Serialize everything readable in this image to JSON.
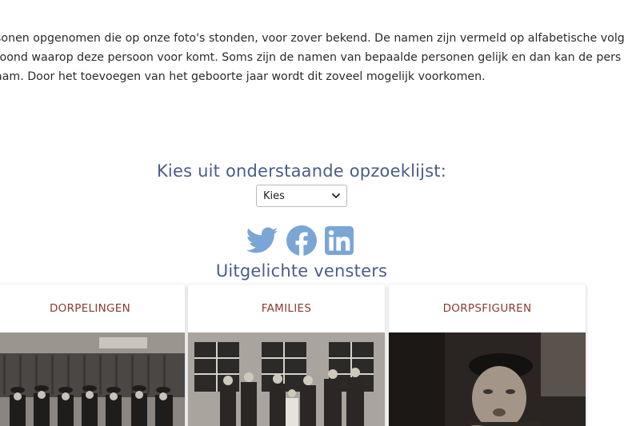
{
  "intro": {
    "line1": "sonen opgenomen die op onze foto's stonden, voor zover bekend. De namen zijn vermeld op alfabetische volg",
    "line2": "roond waarop deze persoon voor komt. Soms zijn de namen van bepaalde personen gelijk en dan kan de pers",
    "line3": "aam. Door het toevoegen van het geboorte jaar wordt dit zoveel mogelijk voorkomen."
  },
  "lookup": {
    "title": "Kies uit onderstaande opzoeklijst:",
    "selected": "Kies"
  },
  "social": {
    "icons": [
      "twitter-icon",
      "facebook-icon",
      "linkedin-icon"
    ],
    "color": "#7aa6d6"
  },
  "featured": {
    "title": "Uitgelichte vensters",
    "cards": [
      {
        "label": "DORPELINGEN"
      },
      {
        "label": "FAMILIES"
      },
      {
        "label": "DORPSFIGUREN"
      }
    ]
  },
  "colors": {
    "heading": "#4a5d8a",
    "card_label": "#8b3a2f",
    "body_text": "#2b2b2b"
  }
}
